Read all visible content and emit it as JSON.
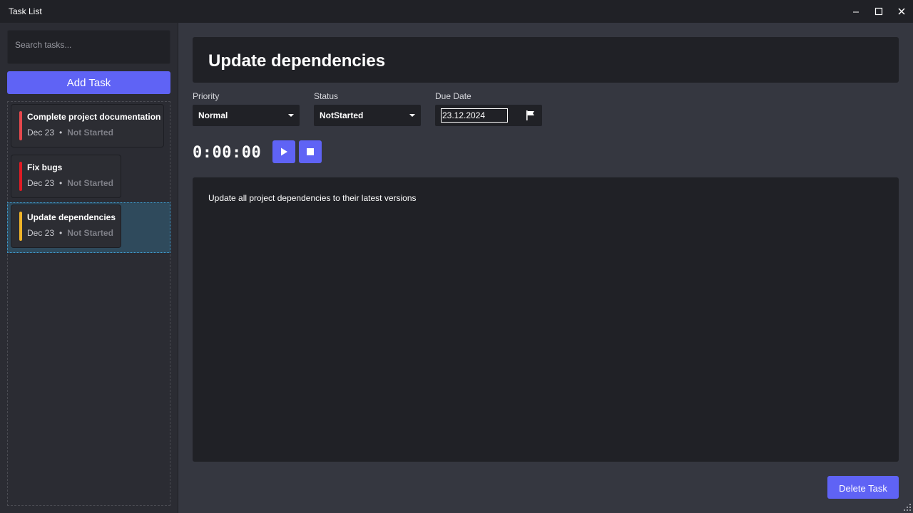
{
  "window": {
    "title": "Task List"
  },
  "sidebar": {
    "search_placeholder": "Search tasks...",
    "add_label": "Add Task",
    "tasks": [
      {
        "title": "Complete project documentation",
        "date": "Dec 23",
        "separator": "•",
        "status": "Not Started",
        "color": "#e5484d"
      },
      {
        "title": "Fix bugs",
        "date": "Dec 23",
        "separator": "•",
        "status": "Not Started",
        "color": "#e01b24"
      },
      {
        "title": "Update dependencies",
        "date": "Dec 23",
        "separator": "•",
        "status": "Not Started",
        "color": "#f0b429",
        "selected": true
      }
    ]
  },
  "detail": {
    "title": "Update dependencies",
    "priority": {
      "label": "Priority",
      "value": "Normal"
    },
    "status": {
      "label": "Status",
      "value": "NotStarted"
    },
    "due": {
      "label": "Due Date",
      "value": "23.12.2024"
    },
    "timer": "0:00:00",
    "description": "Update all project dependencies to their latest versions",
    "delete_label": "Delete Task"
  },
  "colors": {
    "accent": "#5f63f5",
    "selection": "#2f4a5c",
    "selection_border": "#3ea2d8"
  }
}
